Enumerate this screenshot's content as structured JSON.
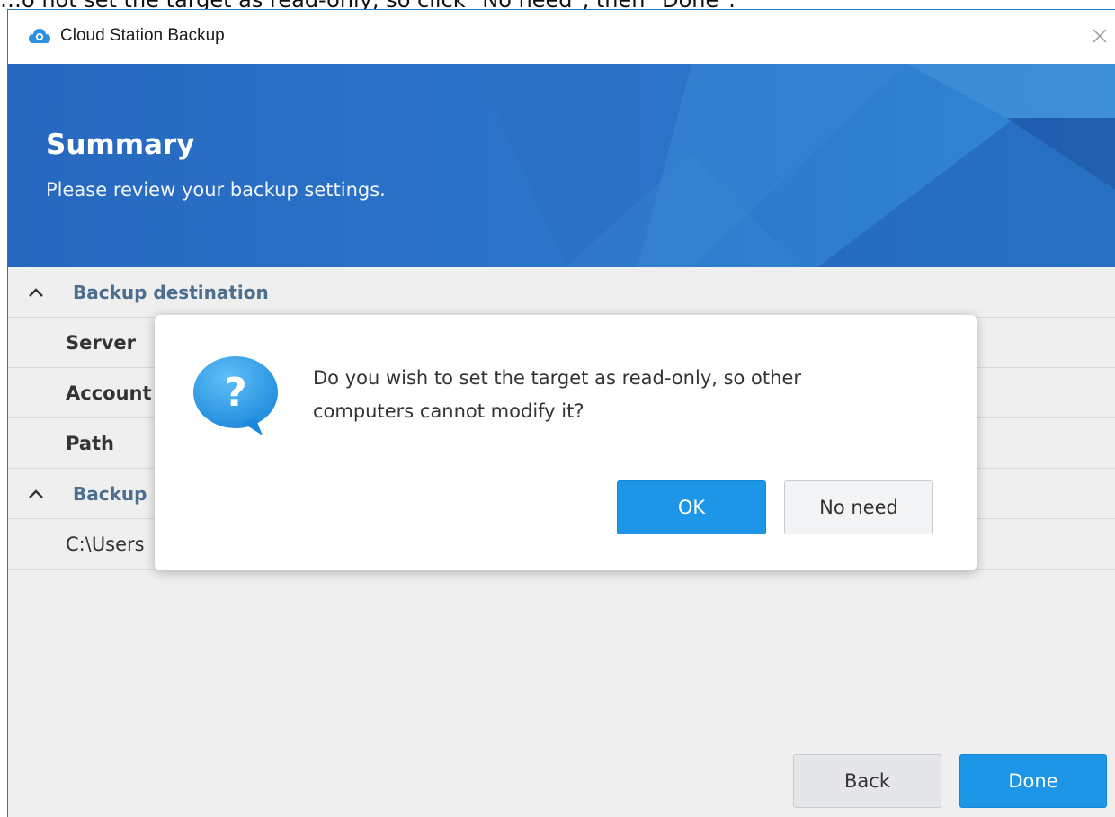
{
  "caption": "…o not set the target as read-only, so click \"No need\", then \"Done\".",
  "window": {
    "title": "Cloud Station Backup"
  },
  "banner": {
    "title": "Summary",
    "subtitle": "Please review your backup settings."
  },
  "sections": {
    "destination": {
      "label": "Backup destination",
      "fields": [
        "Server",
        "Account",
        "Path"
      ]
    },
    "backup_source": {
      "label": "Backup",
      "path": "C:\\Users"
    }
  },
  "footer": {
    "back_label": "Back",
    "done_label": "Done"
  },
  "dialog": {
    "message_line1": "Do you wish to set the target as read-only, so other",
    "message_line2": "computers cannot modify it?",
    "ok_label": "OK",
    "no_need_label": "No need"
  },
  "colors": {
    "accent": "#1e96e8",
    "banner": "#2a73c9",
    "section_header": "#4c6e8f"
  },
  "icons": [
    "cloud-app-icon",
    "close-icon",
    "chevron-up-icon",
    "question-bubble-icon"
  ]
}
